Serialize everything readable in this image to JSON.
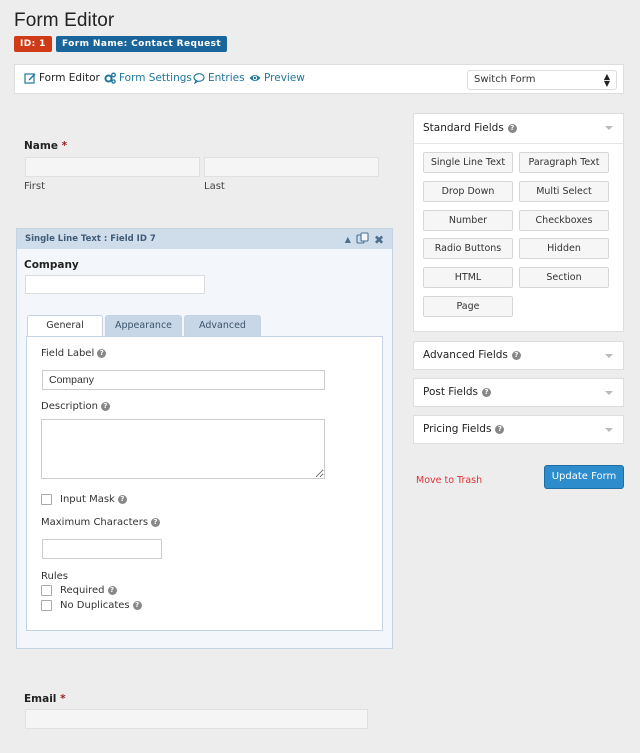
{
  "header": {
    "title": "Form Editor",
    "id_badge": "ID: 1",
    "name_badge": "Form Name: Contact Request"
  },
  "toolbar": {
    "items": [
      {
        "label": "Form Editor",
        "icon": "edit-icon",
        "active": true
      },
      {
        "label": "Form Settings",
        "icon": "gears-icon",
        "active": false
      },
      {
        "label": "Entries",
        "icon": "comment-icon",
        "active": false
      },
      {
        "label": "Preview",
        "icon": "eye-icon",
        "active": false
      }
    ],
    "switch_form": "Switch Form"
  },
  "form": {
    "name_field": {
      "label": "Name",
      "required_mark": "*",
      "first_label": "First",
      "last_label": "Last"
    },
    "selected_field": {
      "header": "Single Line Text : Field ID 7",
      "label": "Company",
      "tabs": [
        "General",
        "Appearance",
        "Advanced"
      ],
      "active_tab": "General",
      "general": {
        "field_label_label": "Field Label",
        "field_label_value": "Company",
        "description_label": "Description",
        "description_value": "",
        "input_mask_label": "Input Mask",
        "max_chars_label": "Maximum Characters",
        "max_chars_value": "",
        "rules_label": "Rules",
        "required_label": "Required",
        "no_duplicates_label": "No Duplicates"
      }
    },
    "email_field": {
      "label": "Email",
      "required_mark": "*"
    }
  },
  "sidebar": {
    "standard_fields": {
      "title": "Standard Fields",
      "buttons": [
        "Single Line Text",
        "Paragraph Text",
        "Drop Down",
        "Multi Select",
        "Number",
        "Checkboxes",
        "Radio Buttons",
        "Hidden",
        "HTML",
        "Section",
        "Page"
      ]
    },
    "collapsed_panels": [
      "Advanced Fields",
      "Post Fields",
      "Pricing Fields"
    ],
    "move_to_trash": "Move to Trash",
    "update_form": "Update Form"
  }
}
